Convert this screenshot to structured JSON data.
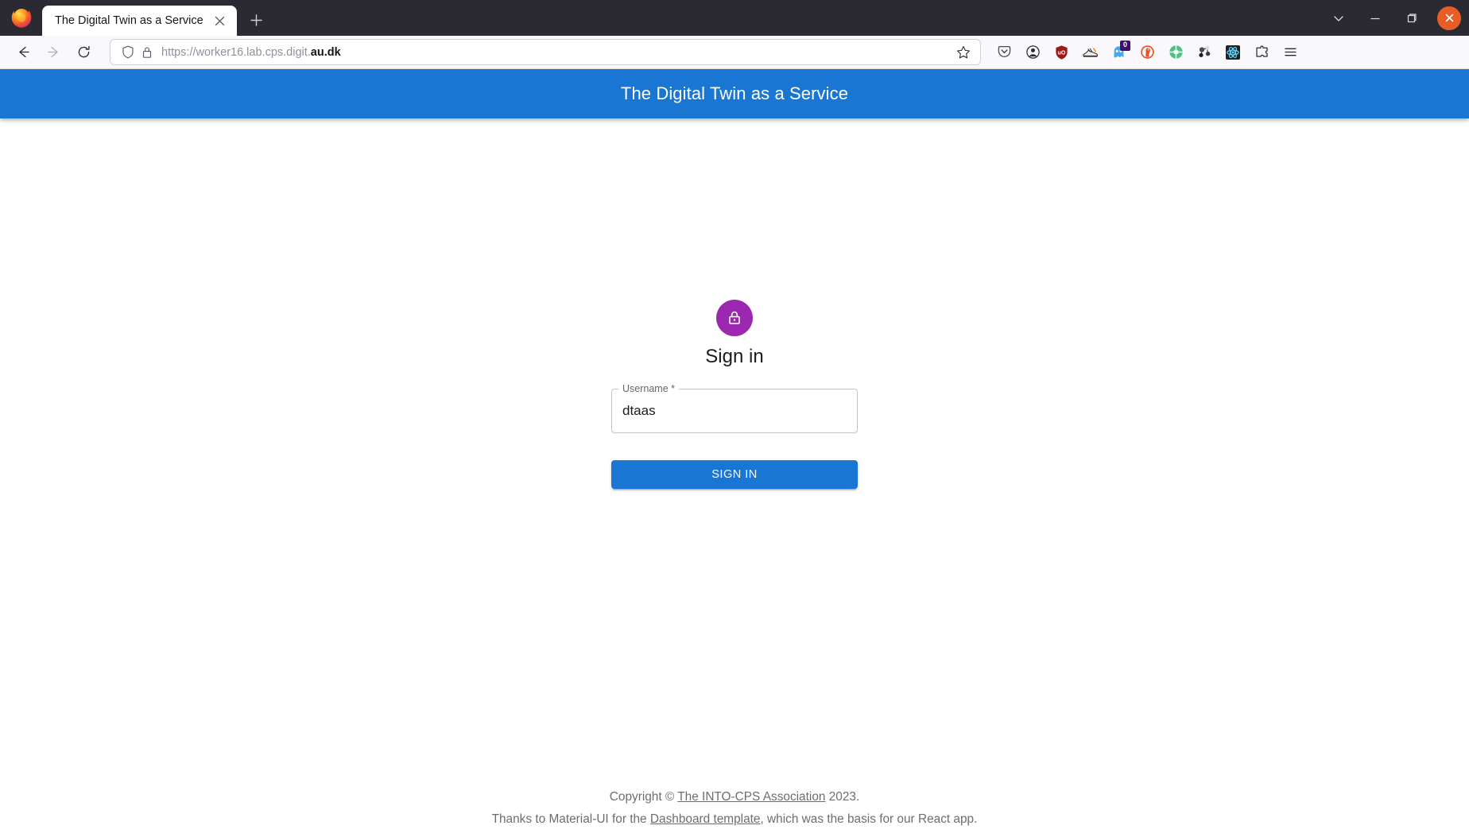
{
  "browser": {
    "tab": {
      "title": "The Digital Twin as a Service",
      "close_icon": "close-icon"
    },
    "new_tab_label": "+",
    "nav": {
      "back_icon": "back-arrow-icon",
      "forward_icon": "forward-arrow-icon",
      "reload_icon": "reload-icon"
    },
    "url": {
      "value_prefix": "https://worker16.lab.cps.digit.",
      "value_domain": "au.dk",
      "full_value": "https://worker16.lab.cps.digit.au.dk",
      "shield_icon": "shield-icon",
      "lock_icon": "padlock-icon",
      "bookmark_icon": "star-icon"
    },
    "extensions": [
      {
        "name": "pocket-icon",
        "label": "Save to Pocket"
      },
      {
        "name": "account-icon",
        "label": "Account"
      },
      {
        "name": "ublock-origin-icon",
        "label": "uBlock Origin"
      },
      {
        "name": "sneaker-icon",
        "label": "Extension"
      },
      {
        "name": "ghostery-icon",
        "label": "Ghostery",
        "badge": "0"
      },
      {
        "name": "duckduckgo-icon",
        "label": "DuckDuckGo Privacy Essentials"
      },
      {
        "name": "green-circle-icon",
        "label": "Extension"
      },
      {
        "name": "molecule-icon",
        "label": "Extension"
      },
      {
        "name": "react-devtools-icon",
        "label": "React Developer Tools"
      },
      {
        "name": "puzzle-piece-icon",
        "label": "Extensions"
      },
      {
        "name": "hamburger-menu-icon",
        "label": "Open application menu"
      }
    ],
    "window_controls": {
      "list_tabs_icon": "chevron-down-icon",
      "minimize_icon": "minimize-icon",
      "maximize_icon": "maximize-icon",
      "close_icon": "close-icon"
    }
  },
  "app": {
    "appbar": {
      "title": "The Digital Twin as a Service",
      "background": "#1976d2",
      "text_color": "#ffffff"
    },
    "signin": {
      "avatar_icon": "lock-icon",
      "avatar_color": "#9c27b0",
      "heading": "Sign in",
      "username_field": {
        "label": "Username *",
        "value": "dtaas",
        "placeholder": ""
      },
      "submit_label": "SIGN IN",
      "submit_color": "#1976d2"
    },
    "footer": {
      "line1": {
        "before": "Copyright © ",
        "link": "The INTO-CPS Association",
        "after": " 2023."
      },
      "line2": {
        "before": "Thanks to Material-UI for the ",
        "link": "Dashboard template",
        "after": ", which was the basis for our React app."
      }
    }
  }
}
